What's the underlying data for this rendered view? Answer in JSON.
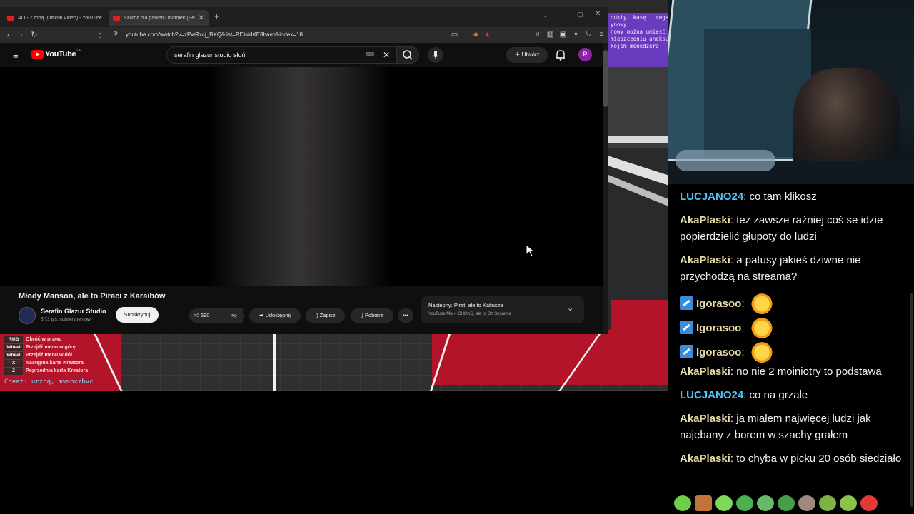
{
  "browser": {
    "tabs": [
      {
        "title": "ALI - Z tobą (Official Video) - YouTube",
        "active": false
      },
      {
        "title": "Szarda dla panien i matołek (Serafi...",
        "active": true
      }
    ],
    "url": "youtube.com/watch?v=zPwRxcj_BXQ&list=RDisidXE8havo&index=18"
  },
  "youtube": {
    "logo_text": "YouTube",
    "region": "DE",
    "search_value": "serafin glazur studio słoń",
    "create_label": "Utwórz",
    "avatar_letter": "P",
    "video_title": "Młody Manson, ale to Piraci z Karaibów",
    "channel_name": "Serafin Glazur Studio",
    "subscribers": "5,73 tys. subskrybentów",
    "subscribe_label": "Subskrybuj",
    "like_count": "690",
    "share_label": "Udostępnij",
    "save_label": "Zapisz",
    "download_label": "Pobierz",
    "next_title": "Następny: Pirat, ale to Katiusza",
    "next_subtitle": "YouTube Mix – CHCwD, ale to Oh Susanna"
  },
  "game": {
    "note_lines": [
      "dukty, kasę i regał",
      "ynowy",
      "",
      "nowy można umieść",
      "mieszczeniu aneksu",
      "kojem menedżera"
    ],
    "keybinds": [
      {
        "key": "RMB",
        "label": "Obróć w prawo"
      },
      {
        "key": "Wheel Up",
        "label": "Przejdź menu w górę"
      },
      {
        "key": "Wheel Down",
        "label": "Przejdź menu w dół"
      },
      {
        "key": "X",
        "label": "Następna karta Kreatora"
      },
      {
        "key": "Z",
        "label": "Poprzednia karta Kreatora"
      }
    ],
    "cheat_text": "Cheat: urzbq, mvnbxzbvc"
  },
  "chat": {
    "messages": [
      {
        "user": "LUCJANO24",
        "text": "co tam klikosz",
        "color": "#4fc3f7"
      },
      {
        "user": "AkaPlaski",
        "text": "też zawsze raźniej coś se idzie popierdzielić głupoty do ludzi",
        "color": "#e8d9a8"
      },
      {
        "user": "AkaPlaski",
        "text": "a patusy jakieś dziwne nie przychodzą na streama?",
        "color": "#e8d9a8"
      },
      {
        "user": "Igorasoo",
        "text": "",
        "color": "#e8d9a8",
        "emote": "fire-duck-emote"
      },
      {
        "user": "Igorasoo",
        "text": "",
        "color": "#e8d9a8",
        "emote": "fire-duck-emote"
      },
      {
        "user": "Igorasoo",
        "text": "",
        "color": "#e8d9a8",
        "emote": "fire-duck-emote"
      },
      {
        "user": "AkaPlaski",
        "text": "no nie 2 moiniotry to podstawa",
        "color": "#e8d9a8"
      },
      {
        "user": "LUCJANO24",
        "text": "co na grzale",
        "color": "#4fc3f7"
      },
      {
        "user": "AkaPlaski",
        "text": "ja miałem najwięcej ludzi jak najebany z borem w szachy grałem",
        "color": "#e8d9a8"
      },
      {
        "user": "AkaPlaski",
        "text": "to chyba w picku 20 osób siedziało",
        "color": "#e8d9a8"
      }
    ],
    "emote_bar": [
      "#6fcf4a",
      "#c0743a",
      "#7ed957",
      "#4caf50",
      "#66bb6a",
      "#43a047",
      "#a1887f",
      "#7cb342",
      "#8bc34a",
      "#e53935"
    ]
  },
  "colors": {
    "youtube_red": "#ff0000",
    "game_red": "#b3142a",
    "note_purple": "#6a3bbf"
  }
}
